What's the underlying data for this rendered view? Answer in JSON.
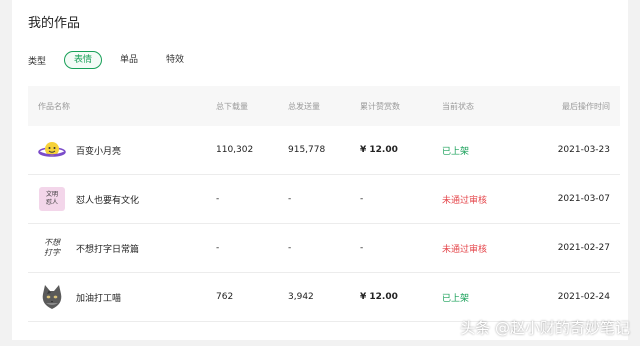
{
  "page": {
    "title": "我的作品"
  },
  "filter": {
    "label": "类型",
    "tabs": [
      {
        "label": "表情",
        "active": true
      },
      {
        "label": "单品",
        "active": false
      },
      {
        "label": "特效",
        "active": false
      }
    ]
  },
  "table": {
    "headers": {
      "name": "作品名称",
      "downloads": "总下载量",
      "sent": "总发送量",
      "tips": "累计赞赏数",
      "status": "当前状态",
      "last_time": "最后操作时间"
    },
    "rows": [
      {
        "name": "百变小月亮",
        "downloads": "110,302",
        "sent": "915,778",
        "tips": "¥ 12.00",
        "status": "已上架",
        "last_time": "2021-03-23"
      },
      {
        "name": "怼人也要有文化",
        "downloads": "-",
        "sent": "-",
        "tips": "-",
        "status": "未通过审核",
        "last_time": "2021-03-07"
      },
      {
        "name": "不想打字日常篇",
        "downloads": "-",
        "sent": "-",
        "tips": "-",
        "status": "未通过审核",
        "last_time": "2021-02-27"
      },
      {
        "name": "加油打工喵",
        "downloads": "762",
        "sent": "3,942",
        "tips": "¥ 12.00",
        "status": "已上架",
        "last_time": "2021-02-24"
      }
    ],
    "thumb2_text": [
      "文明",
      "怼人"
    ],
    "thumb3_text": [
      "不想",
      "打字"
    ]
  },
  "colors": {
    "accent": "#18a058",
    "error": "#e5484d"
  },
  "watermark": "头条 @赵小财的奇妙笔记"
}
